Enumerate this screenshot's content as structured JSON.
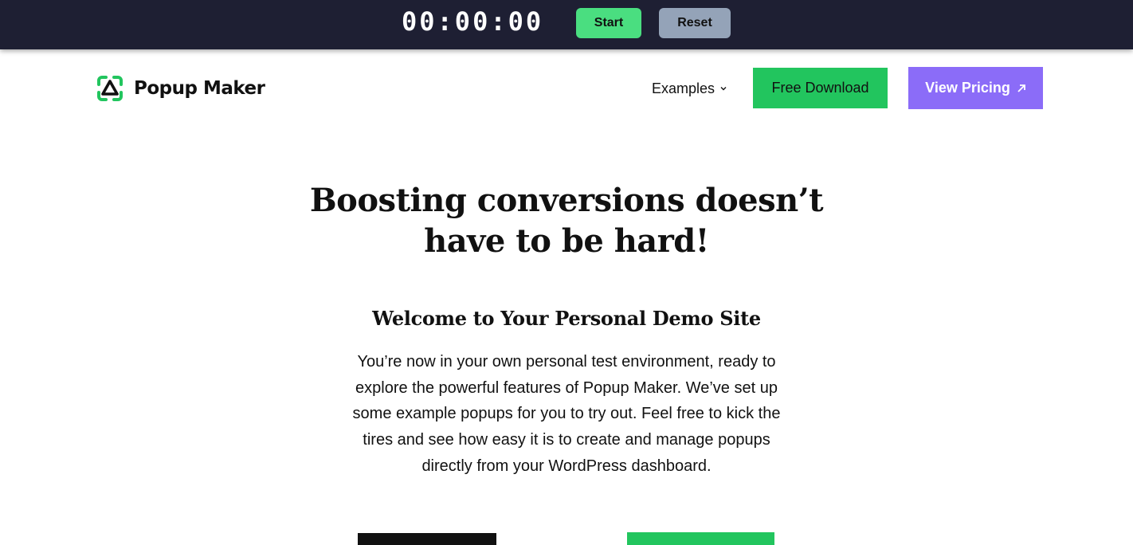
{
  "timer": {
    "display": "00:00:00",
    "start_label": "Start",
    "reset_label": "Reset"
  },
  "header": {
    "logo_text": "Popup Maker",
    "logo_icon": "popup-maker-logo-icon",
    "nav": {
      "examples_label": "Examples",
      "examples_icon": "chevron-down-icon"
    },
    "free_download_label": "Free Download",
    "view_pricing_label": "View Pricing",
    "view_pricing_icon": "arrow-up-right-icon"
  },
  "hero": {
    "title_line1": "Boosting conversions doesn’t",
    "title_line2": "have to be hard!",
    "subtitle": "Welcome to Your Personal Demo Site",
    "intro_line1": "You’re now in your own personal test environment, ready to",
    "intro_line2": "explore the powerful features of Popup Maker. We’ve set up",
    "intro_line3": "some example popups for you to try out. Feel free to kick the",
    "intro_line4": "tires and see how easy it is to create and manage popups",
    "intro_line5": "directly from your WordPress dashboard."
  },
  "colors": {
    "timer_bar": "#1e1f33",
    "start_button": "#4ade80",
    "reset_button": "#94a3b8",
    "brand_green": "#22c55e",
    "brand_purple": "#8b6cf8",
    "cta_dark": "#111111"
  }
}
